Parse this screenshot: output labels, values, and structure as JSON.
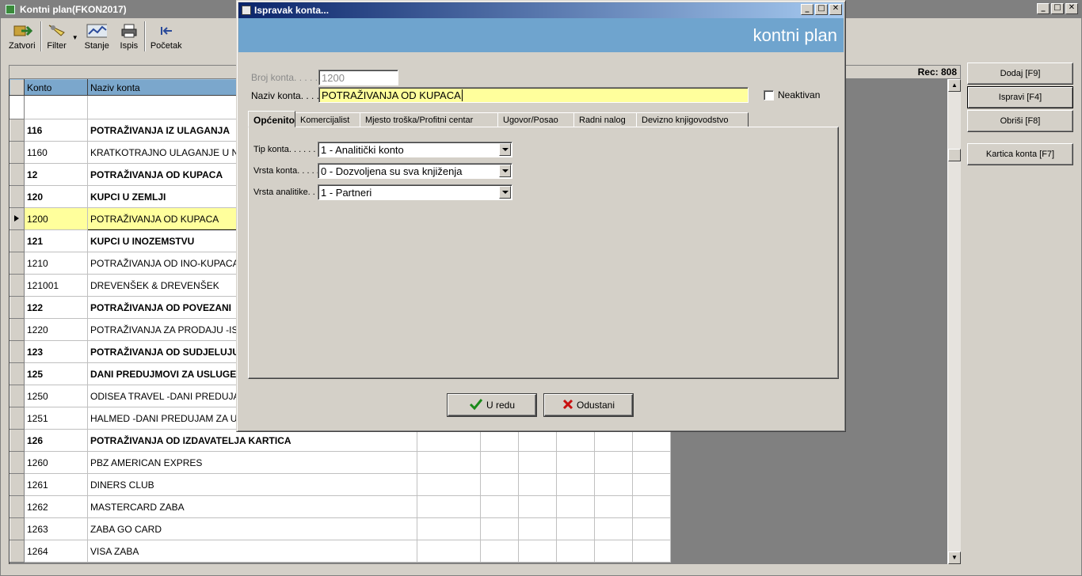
{
  "main": {
    "title": "Kontni plan(FKON2017)",
    "toolbar": [
      {
        "label": "Zatvori",
        "icon": "exit-icon"
      },
      {
        "label": "Filter",
        "icon": "filter-icon"
      },
      {
        "label": "Stanje",
        "icon": "chart-icon"
      },
      {
        "label": "Ispis",
        "icon": "printer-icon"
      },
      {
        "label": "Početak",
        "icon": "first-record-icon"
      }
    ],
    "rec_label": "Rec: 808",
    "columns": {
      "konto": "Konto",
      "naziv": "Naziv konta"
    },
    "rows": [
      {
        "konto": "116",
        "naziv": "POTRAŽIVANJA IZ ULAGANJA",
        "bold": true
      },
      {
        "konto": "1160",
        "naziv": "KRATKOTRAJNO ULAGANJE U NO",
        "bold": false
      },
      {
        "konto": "12",
        "naziv": "POTRAŽIVANJA OD KUPACA",
        "bold": true
      },
      {
        "konto": "120",
        "naziv": "KUPCI U ZEMLJI",
        "bold": true
      },
      {
        "konto": "1200",
        "naziv": "POTRAŽIVANJA OD KUPACA",
        "bold": false,
        "selected": true
      },
      {
        "konto": "121",
        "naziv": "KUPCI U INOZEMSTVU",
        "bold": true
      },
      {
        "konto": "1210",
        "naziv": "POTRAŽIVANJA OD INO-KUPACA",
        "bold": false
      },
      {
        "konto": "121001",
        "naziv": "DREVENŠEK & DREVENŠEK",
        "bold": false
      },
      {
        "konto": "122",
        "naziv": "POTRAŽIVANJA OD POVEZANI",
        "bold": true
      },
      {
        "konto": "1220",
        "naziv": "POTRAŽIVANJA ZA PRODAJU -ISP",
        "bold": false
      },
      {
        "konto": "123",
        "naziv": "POTRAŽIVANJA OD SUDJELUJU",
        "bold": true
      },
      {
        "konto": "125",
        "naziv": "DANI PREDUJMOVI ZA USLUGE",
        "bold": true
      },
      {
        "konto": "1250",
        "naziv": "ODISEA TRAVEL -DANI PREDUJAM",
        "bold": false
      },
      {
        "konto": "1251",
        "naziv": "HALMED -DANI PREDUJAM ZA USL",
        "bold": false
      },
      {
        "konto": "126",
        "naziv": "POTRAŽIVANJA OD IZDAVATELJA KARTICA",
        "bold": true
      },
      {
        "konto": "1260",
        "naziv": "PBZ AMERICAN EXPRES",
        "bold": false
      },
      {
        "konto": "1261",
        "naziv": "DINERS CLUB",
        "bold": false
      },
      {
        "konto": "1262",
        "naziv": "MASTERCARD ZABA",
        "bold": false
      },
      {
        "konto": "1263",
        "naziv": "ZABA GO CARD",
        "bold": false
      },
      {
        "konto": "1264",
        "naziv": "VISA ZABA",
        "bold": false
      }
    ],
    "side_buttons": {
      "dodaj": "Dodaj [F9]",
      "ispravi": "Ispravi [F4]",
      "obrisi": "Obriši [F8]",
      "kartica": "Kartica konta [F7]"
    }
  },
  "dialog": {
    "title": "Ispravak konta...",
    "banner": "kontni plan",
    "broj_label": "Broj konta. . . . . .",
    "broj_value": "1200",
    "naziv_label": "Naziv konta. . . .",
    "naziv_value": "POTRAŽIVANJA OD KUPACA",
    "neaktivan_label": "Neaktivan",
    "tabs": [
      "Općenito",
      "Komercijalist",
      "Mjesto troška/Profitni centar",
      "Ugovor/Posao",
      "Radni nalog",
      "Devizno knjigovodstvo"
    ],
    "tip_label": "Tip konta. . . . . .",
    "tip_value": "1 - Analitički konto",
    "vrsta_label": "Vrsta konta. . . . .",
    "vrsta_value": "0 - Dozvoljena su sva knjiženja",
    "analitika_label": "Vrsta analitike. . .",
    "analitika_value": "1 - Partneri",
    "ok_label": "U redu",
    "cancel_label": "Odustani"
  }
}
